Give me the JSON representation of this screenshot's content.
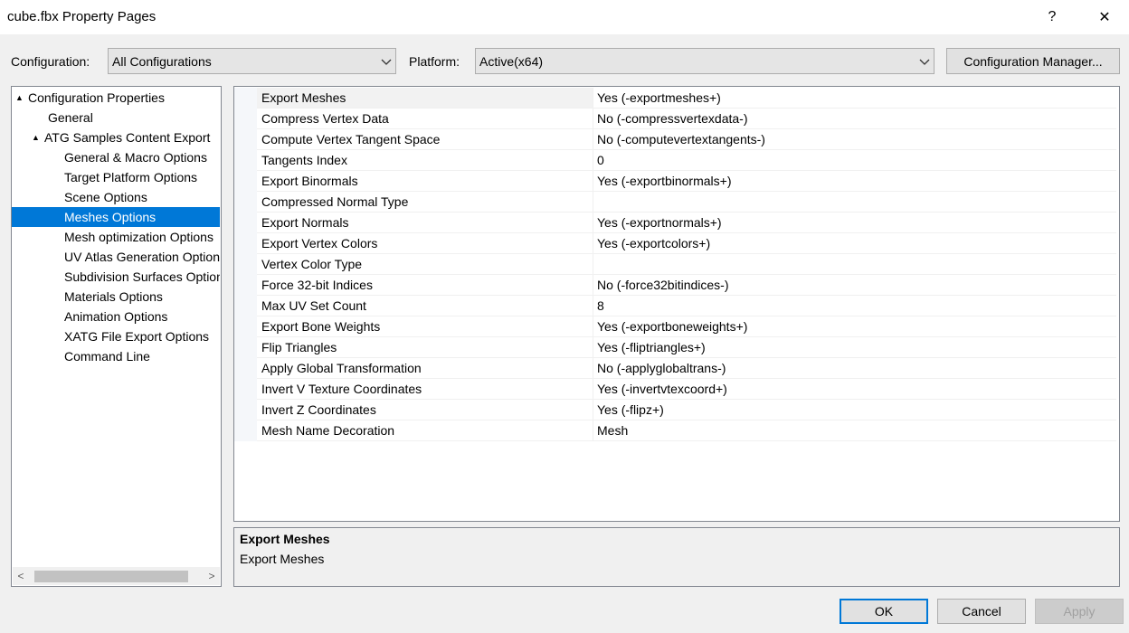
{
  "window": {
    "title": "cube.fbx Property Pages",
    "help_label": "?",
    "close_label": "✕"
  },
  "toolbar": {
    "configuration_label": "Configuration:",
    "configuration_value": "All Configurations",
    "platform_label": "Platform:",
    "platform_value": "Active(x64)",
    "config_manager_label": "Configuration Manager..."
  },
  "tree": {
    "items": [
      {
        "label": "Configuration Properties",
        "expanded": true,
        "selected": false
      },
      {
        "label": "General",
        "selected": false
      },
      {
        "label": "ATG Samples Content Export",
        "expanded": true,
        "selected": false
      },
      {
        "label": "General & Macro Options",
        "selected": false
      },
      {
        "label": "Target Platform Options",
        "selected": false
      },
      {
        "label": "Scene Options",
        "selected": false
      },
      {
        "label": "Meshes Options",
        "selected": true
      },
      {
        "label": "Mesh optimization Options",
        "selected": false
      },
      {
        "label": "UV Atlas Generation Options",
        "selected": false
      },
      {
        "label": "Subdivision Surfaces Options",
        "selected": false
      },
      {
        "label": "Materials Options",
        "selected": false
      },
      {
        "label": "Animation Options",
        "selected": false
      },
      {
        "label": "XATG File Export Options",
        "selected": false
      },
      {
        "label": "Command Line",
        "selected": false
      }
    ],
    "expander_icon": "▲",
    "scroll_left": "<",
    "scroll_right": ">"
  },
  "properties": [
    {
      "name": "Export Meshes",
      "value": "Yes (-exportmeshes+)"
    },
    {
      "name": "Compress Vertex Data",
      "value": "No (-compressvertexdata-)"
    },
    {
      "name": "Compute Vertex Tangent Space",
      "value": "No (-computevertextangents-)"
    },
    {
      "name": "Tangents Index",
      "value": "0"
    },
    {
      "name": "Export Binormals",
      "value": "Yes (-exportbinormals+)"
    },
    {
      "name": "Compressed Normal Type",
      "value": ""
    },
    {
      "name": "Export Normals",
      "value": "Yes (-exportnormals+)"
    },
    {
      "name": "Export Vertex Colors",
      "value": "Yes (-exportcolors+)"
    },
    {
      "name": "Vertex Color Type",
      "value": ""
    },
    {
      "name": "Force 32-bit Indices",
      "value": "No (-force32bitindices-)"
    },
    {
      "name": "Max UV Set Count",
      "value": "8"
    },
    {
      "name": "Export Bone Weights",
      "value": "Yes (-exportboneweights+)"
    },
    {
      "name": "Flip Triangles",
      "value": "Yes (-fliptriangles+)"
    },
    {
      "name": "Apply Global Transformation",
      "value": "No (-applyglobaltrans-)"
    },
    {
      "name": "Invert V Texture Coordinates",
      "value": "Yes (-invertvtexcoord+)"
    },
    {
      "name": "Invert Z Coordinates",
      "value": "Yes (-flipz+)"
    },
    {
      "name": "Mesh Name Decoration",
      "value": "Mesh"
    }
  ],
  "description": {
    "title": "Export Meshes",
    "text": "Export Meshes"
  },
  "buttons": {
    "ok": "OK",
    "cancel": "Cancel",
    "apply": "Apply"
  },
  "colors": {
    "selection": "#0078d7"
  }
}
